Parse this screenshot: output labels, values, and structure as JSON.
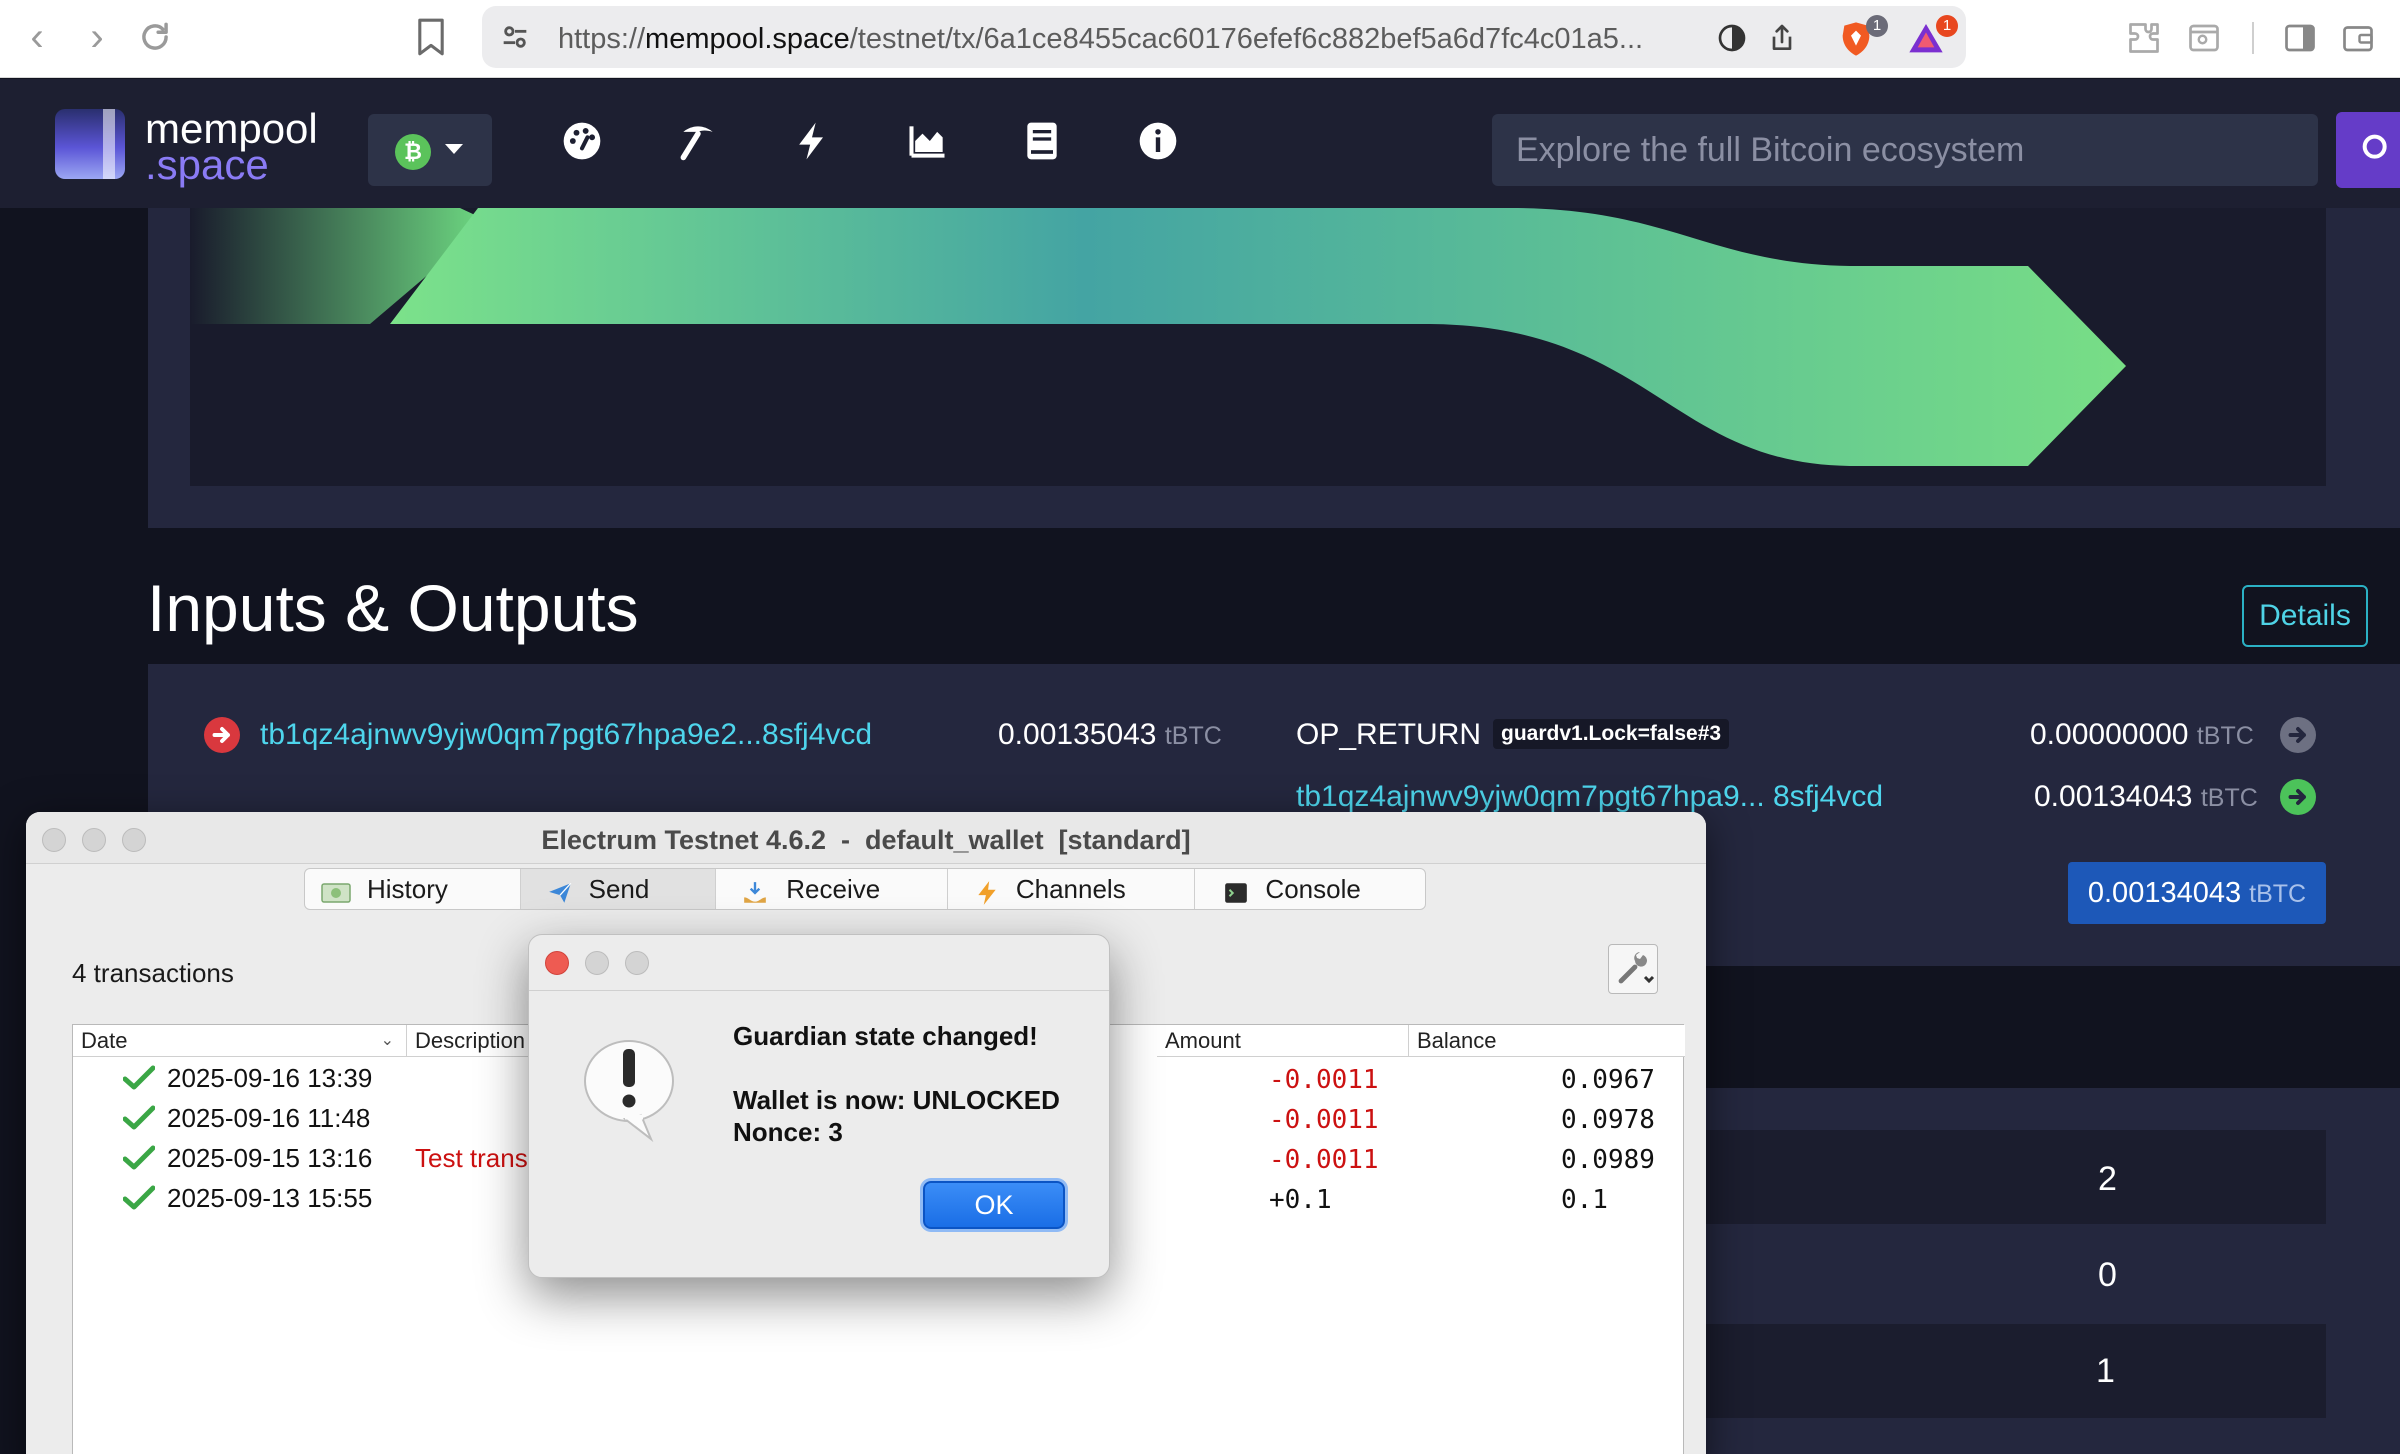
{
  "browser": {
    "url_prefix": "https://",
    "url_host": "mempool.space",
    "url_path": "/testnet/tx/6a1ce8455cac60176efef6c882bef5a6d7fc4c01a5...",
    "brave_badge": "1",
    "rewards_badge": "1"
  },
  "mempool": {
    "logo_line1": "mempool",
    "logo_line2": ".space",
    "search_placeholder": "Explore the full Bitcoin ecosystem",
    "nav_icons": [
      "dashboard-icon",
      "mining-icon",
      "lightning-icon",
      "graphs-icon",
      "docs-icon",
      "about-icon"
    ],
    "section_title": "Inputs & Outputs",
    "details_label": "Details",
    "input": {
      "address": "tb1qz4ajnwv9yjw0qm7pgt67hpa9e2...8sfj4vcd",
      "amount": "0.00135043",
      "unit": "tBTC"
    },
    "outputs": [
      {
        "label": "OP_RETURN",
        "tag": "guardv1.Lock=false#3",
        "amount": "0.00000000",
        "unit": "tBTC"
      },
      {
        "address": "tb1qz4ajnwv9yjw0qm7pgt67hpa9... 8sfj4vcd",
        "amount": "0.00134043",
        "unit": "tBTC"
      }
    ],
    "total": {
      "amount": "0.00134043",
      "unit": "tBTC"
    },
    "stats": [
      "2",
      "0",
      "1"
    ],
    "colors": {
      "accent": "#4ed5ec",
      "bg": "#11131f",
      "panel": "#24273e",
      "flow": "#6fdc83"
    }
  },
  "electrum": {
    "title": "Electrum Testnet 4.6.2  -  default_wallet  [standard]",
    "tabs": [
      {
        "label": "History",
        "icon": "history-icon"
      },
      {
        "label": "Send",
        "icon": "send-icon"
      },
      {
        "label": "Receive",
        "icon": "receive-icon"
      },
      {
        "label": "Channels",
        "icon": "channels-icon"
      },
      {
        "label": "Console",
        "icon": "console-icon"
      }
    ],
    "tx_count": "4 transactions",
    "columns": {
      "date": "Date",
      "description": "Description",
      "amount": "Amount",
      "balance": "Balance"
    },
    "rows": [
      {
        "date": "2025-09-16 13:39",
        "description": "",
        "amount": "-0.0011",
        "balance": "0.0967"
      },
      {
        "date": "2025-09-16 11:48",
        "description": "",
        "amount": "-0.0011",
        "balance": "0.0978"
      },
      {
        "date": "2025-09-15 13:16",
        "description": "Test trans",
        "amount": "-0.0011",
        "balance": "0.0989"
      },
      {
        "date": "2025-09-13 15:55",
        "description": "",
        "amount": "+0.1",
        "balance": "0.1"
      }
    ]
  },
  "dialog": {
    "heading": "Guardian state changed!",
    "line1": "Wallet is now: UNLOCKED",
    "line2": "Nonce: 3",
    "ok_label": "OK"
  }
}
